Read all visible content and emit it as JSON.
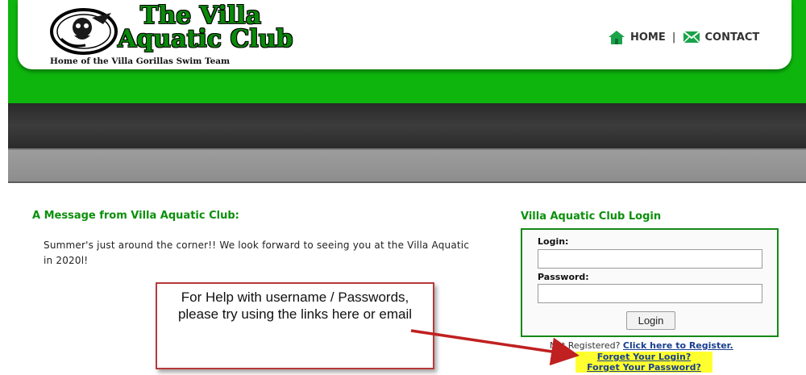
{
  "header": {
    "logo": {
      "line1": "The Villa",
      "line2": "Aquatic Club",
      "tagline": "Home of the Villa Gorillas Swim Team"
    },
    "nav": {
      "home": "HOME",
      "separator": "|",
      "contact": "CONTACT"
    }
  },
  "message": {
    "heading": "A Message from Villa Aquatic Club:",
    "body": "Summer's just around the corner!! We look forward to seeing you at the Villa Aquatic in 2020l!"
  },
  "login": {
    "heading": "Villa Aquatic Club Login",
    "login_label": "Login:",
    "login_value": "",
    "password_label": "Password:",
    "password_value": "",
    "button_label": "Login"
  },
  "register": {
    "prompt": "Not Registered?",
    "link": "Click here to Register."
  },
  "forget": {
    "login": "Forget Your Login?",
    "password": "Forget Your Password?"
  },
  "callout": {
    "text": "For Help with username / Passwords, please try using the links here or email"
  },
  "colors": {
    "brand_green": "#0db50d",
    "heading_green": "#0b8f0b",
    "highlight_yellow": "#ffff2f",
    "callout_red": "#b83a3a",
    "link_blue": "#1a3f8f"
  },
  "icons": [
    "gorilla-emblem-icon",
    "home-icon",
    "mail-icon",
    "arrow-icon"
  ]
}
